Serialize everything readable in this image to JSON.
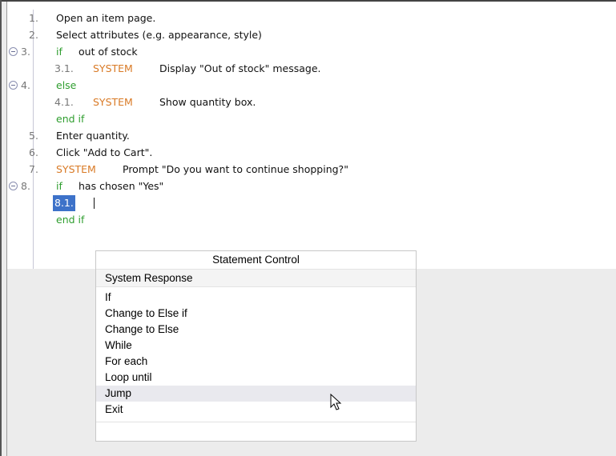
{
  "editor": {
    "lines": [
      {
        "num": "1.",
        "text": "Open an item page."
      },
      {
        "num": "2.",
        "text": "Select attributes (e.g. appearance, style)"
      },
      {
        "num": "3.",
        "keyword": "if",
        "text": "out of stock"
      },
      {
        "num": "3.1.",
        "system": "SYSTEM",
        "text": "Display \"Out of stock\" message."
      },
      {
        "num": "4.",
        "keyword": "else"
      },
      {
        "num": "4.1.",
        "system": "SYSTEM",
        "text": "Show quantity box."
      },
      {
        "keyword": "end if"
      },
      {
        "num": "5.",
        "text": "Enter quantity."
      },
      {
        "num": "6.",
        "text": "Click \"Add to Cart\"."
      },
      {
        "num": "7.",
        "system": "SYSTEM",
        "text": "Prompt \"Do you want to continue shopping?\""
      },
      {
        "num": "8.",
        "keyword": "if",
        "text": "has chosen \"Yes\""
      },
      {
        "num": "8.1."
      },
      {
        "keyword": "end if"
      }
    ]
  },
  "menu": {
    "title": "Statement Control",
    "items": [
      "System Response",
      "If",
      "Change to Else if",
      "Change to Else",
      "While",
      "For each",
      "Loop until",
      "Jump",
      "Exit"
    ],
    "hovered": "Jump"
  }
}
